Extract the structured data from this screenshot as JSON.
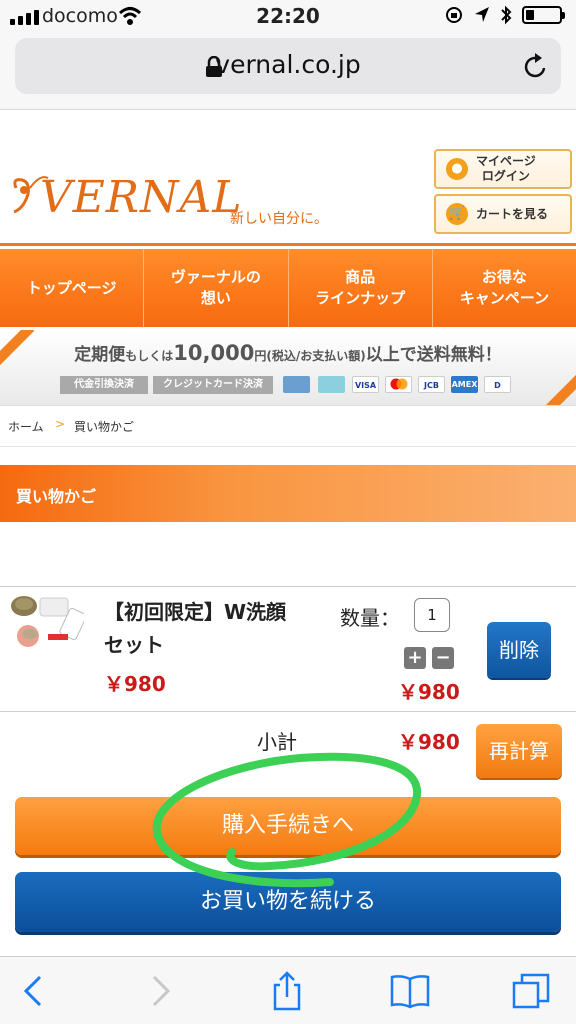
{
  "status_bar": {
    "carrier": "docomo",
    "time": "22:20",
    "battery_level": 0.25
  },
  "browser": {
    "url": "vernal.co.jp"
  },
  "header": {
    "logo_text": "VERNAL",
    "logo_tagline": "新しい自分に。",
    "mypage_line1": "マイページ",
    "mypage_line2": "ログイン",
    "cart_button": "カートを見る"
  },
  "nav": {
    "items": [
      {
        "line1": "トップページ",
        "line2": ""
      },
      {
        "line1": "ヴァーナルの",
        "line2": "想い"
      },
      {
        "line1": "商品",
        "line2": "ラインナップ"
      },
      {
        "line1": "お得な",
        "line2": "キャンペーン"
      }
    ]
  },
  "banner": {
    "text_a": "定期便",
    "text_b": "もしくは",
    "text_c": "10,000",
    "text_d": "円(税込/お支払い額)",
    "text_e": "以上で送料無料！",
    "pay1": "代金引換決済",
    "pay2": "クレジットカード決済",
    "cards": [
      "VISA",
      "MC",
      "JCB",
      "AMEX",
      "D"
    ]
  },
  "breadcrumb": {
    "home": "ホーム",
    "separator": ">",
    "current": "買い物かご"
  },
  "section_title": "買い物かご",
  "cart": {
    "product_name_line1": "【初回限定】W洗顔",
    "product_name_line2": "セット",
    "unit_price": "￥980",
    "quantity_label": "数量：",
    "quantity": "1",
    "plus": "+",
    "minus": "−",
    "line_total": "￥980",
    "delete_button": "削除",
    "subtotal_label": "小計",
    "subtotal_value": "￥980",
    "recalc_button": "再計算"
  },
  "actions": {
    "checkout_button": "購入手続きへ",
    "continue_button": "お買い物を続ける"
  },
  "colors": {
    "accent_orange": "#f57b10",
    "brand_blue": "#0f55a0",
    "price_red": "#cc1a1a",
    "annotation_green": "#3cd054"
  }
}
